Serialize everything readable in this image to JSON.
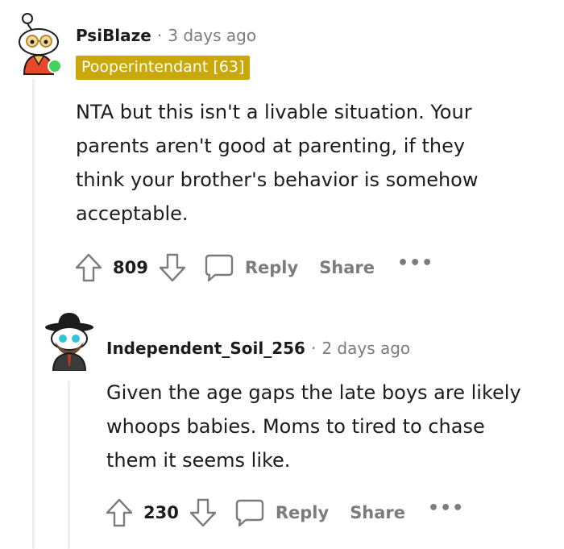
{
  "comments": [
    {
      "username": "PsiBlaze",
      "separator": "·",
      "time": "3 days ago",
      "flair": "Pooperintendant [63]",
      "body_lines": [
        "NTA but this isn't a livable situation. Your",
        "parents aren't good at parenting, if they",
        "think your brother's behavior is somehow",
        "acceptable."
      ],
      "score": "809",
      "reply_label": "Reply",
      "share_label": "Share",
      "more_label": "•••"
    },
    {
      "username": "Independent_Soil_256",
      "separator": "·",
      "time": "2 days ago",
      "body_lines": [
        "Given the age gaps the late boys are likely",
        "whoops babies. Moms to tired to chase",
        "them it seems like."
      ],
      "score": "230",
      "reply_label": "Reply",
      "share_label": "Share",
      "more_label": "•••"
    }
  ],
  "colors": {
    "flair_bg": "#c9a80a",
    "online_dot": "#46d160",
    "muted_text": "#7c7c7c",
    "thread_line": "#edeff1"
  }
}
